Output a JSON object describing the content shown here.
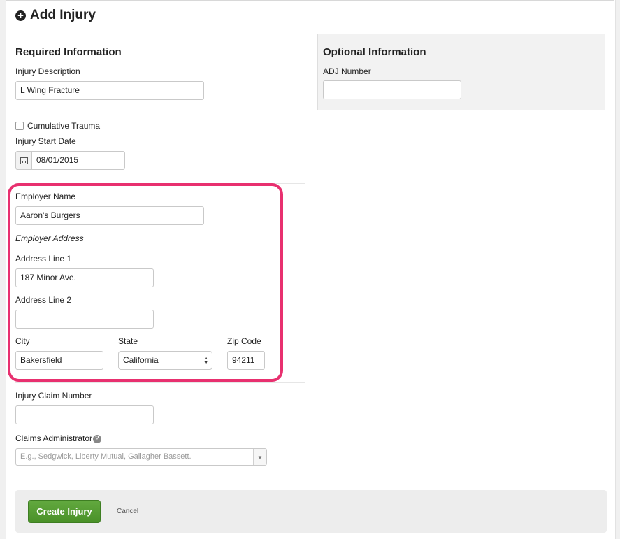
{
  "page_title": "Add Injury",
  "required": {
    "heading": "Required Information",
    "injury_description_label": "Injury Description",
    "injury_description_value": "L Wing Fracture",
    "cumulative_trauma_label": "Cumulative Trauma",
    "injury_start_date_label": "Injury Start Date",
    "injury_start_date_value": "08/01/2015",
    "employer_name_label": "Employer Name",
    "employer_name_value": "Aaron's Burgers",
    "employer_address_label": "Employer Address",
    "address_line1_label": "Address Line 1",
    "address_line1_value": "187 Minor Ave.",
    "address_line2_label": "Address Line 2",
    "address_line2_value": "",
    "city_label": "City",
    "city_value": "Bakersfield",
    "state_label": "State",
    "state_value": "California",
    "zip_label": "Zip Code",
    "zip_value": "94211",
    "claim_number_label": "Injury Claim Number",
    "claim_number_value": "",
    "claims_admin_label": "Claims Administrator",
    "claims_admin_placeholder": "E.g., Sedgwick, Liberty Mutual, Gallagher Bassett."
  },
  "optional": {
    "heading": "Optional Information",
    "adj_number_label": "ADJ Number",
    "adj_number_value": ""
  },
  "footer": {
    "create_label": "Create Injury",
    "cancel_label": "Cancel"
  },
  "colors": {
    "highlight": "#e8306f",
    "primary_button": "#4a9128"
  }
}
